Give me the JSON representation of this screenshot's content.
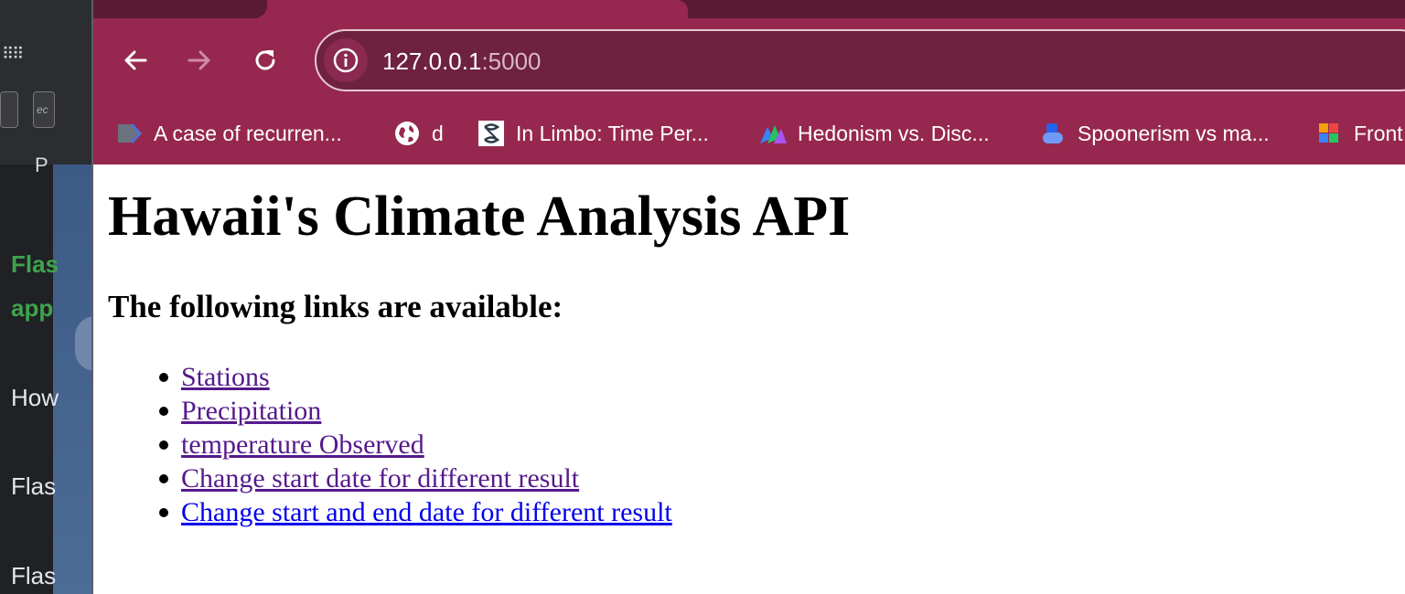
{
  "background_app": {
    "short_label": "P",
    "lines": [
      "Flas",
      "app",
      "How",
      "Flas",
      "Flas"
    ]
  },
  "browser": {
    "url_host": "127.0.0.1",
    "url_port": ":5000",
    "bookmarks": [
      {
        "label": "A case of recurren...",
        "icon": "bookmark-tag-icon"
      },
      {
        "label": "d",
        "icon": "globe-icon"
      },
      {
        "label": "In Limbo: Time Per...",
        "icon": "limbo-icon"
      },
      {
        "label": "Hedonism vs. Disc...",
        "icon": "mountain-icon"
      },
      {
        "label": "Spoonerism vs ma...",
        "icon": "person-icon"
      },
      {
        "label": "Front",
        "icon": "puzzle-icon"
      }
    ],
    "colors": {
      "frame": "#96284f",
      "omnibox": "#6f2140",
      "tabstrip": "#5b1a33"
    }
  },
  "page": {
    "title": "Hawaii's Climate Analysis API",
    "subtitle": "The following links are available:",
    "links": [
      {
        "label": "Stations",
        "state": "visited"
      },
      {
        "label": "Precipitation",
        "state": "visited"
      },
      {
        "label": "temperature Observed",
        "state": "visited"
      },
      {
        "label": "Change start date for different result",
        "state": "visited"
      },
      {
        "label": "Change start and end date for different result",
        "state": "unvisited"
      }
    ]
  }
}
